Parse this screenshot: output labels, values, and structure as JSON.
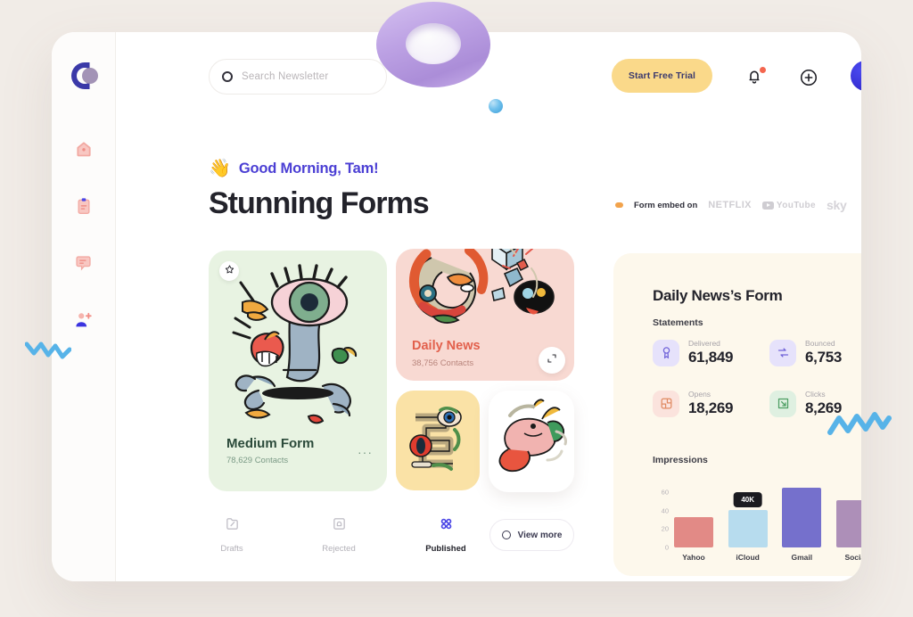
{
  "app": {
    "logo_name": "brand-logo"
  },
  "search": {
    "placeholder": "Search Newsletter",
    "value": ""
  },
  "header": {
    "cta_label": "Start Free Trial",
    "bell_icon": "notification-bell-icon",
    "plus_icon": "add-circle-icon",
    "avatar_icon": "user-avatar"
  },
  "sidebar": {
    "items": [
      {
        "name": "home",
        "icon": "home-icon",
        "active": false
      },
      {
        "name": "forms",
        "icon": "clipboard-icon",
        "active": false
      },
      {
        "name": "messages",
        "icon": "chat-bubble-icon",
        "active": false
      },
      {
        "name": "add-user",
        "icon": "add-user-icon",
        "active": true
      }
    ]
  },
  "greeting": {
    "emoji": "👋",
    "text": "Good Morning, Tam!"
  },
  "page_title": "Stunning Forms",
  "embed": {
    "label": "Form embed on",
    "brands": [
      "NETFLIX",
      "YouTube",
      "sky"
    ]
  },
  "cards": [
    {
      "id": "medium-form",
      "title": "Medium Form",
      "contacts": "78,629 Contacts",
      "pin_icon": "pin-icon",
      "more_icon": "more-options-icon",
      "bg": "#e8f3e2"
    },
    {
      "id": "daily-news",
      "title": "Daily News",
      "contacts": "38,756 Contacts",
      "expand_icon": "expand-icon",
      "bg": "#f8d9d2"
    }
  ],
  "tabs": [
    {
      "label": "Drafts",
      "icon": "drafts-icon",
      "active": false
    },
    {
      "label": "Rejected",
      "icon": "rejected-icon",
      "active": false
    },
    {
      "label": "Published",
      "icon": "grid-dots-icon",
      "active": true
    }
  ],
  "view_more": {
    "label": "View more"
  },
  "panel": {
    "title": "Daily News’s Form",
    "close_icon": "close-circle-icon",
    "statements_label": "Statements",
    "impressions_label": "Impressions",
    "stats": [
      {
        "label": "Delivered",
        "value": "61,849",
        "icon": "badge-icon",
        "icon_bg": "#e6e2fb",
        "icon_color": "#6f62d8"
      },
      {
        "label": "Bounced",
        "value": "6,753",
        "icon": "swap-icon",
        "icon_bg": "#e6e2fb",
        "icon_color": "#6f62d8"
      },
      {
        "label": "Opens",
        "value": "18,269",
        "icon": "frame-icon",
        "icon_bg": "#fbe3dd",
        "icon_color": "#e08a62"
      },
      {
        "label": "Clicks",
        "value": "8,269",
        "icon": "cursor-icon",
        "icon_bg": "#dff0e1",
        "icon_color": "#4e9e63"
      }
    ]
  },
  "chart_data": {
    "type": "bar",
    "title": "Impressions",
    "categories": [
      "Yahoo",
      "iCloud",
      "Gmail",
      "Social"
    ],
    "values": [
      33,
      41,
      65,
      52
    ],
    "colors": [
      "#e28a86",
      "#b7dcee",
      "#7570cc",
      "#ad8fb8"
    ],
    "ylim": [
      0,
      70
    ],
    "yticks": [
      0,
      20,
      40,
      60
    ],
    "ytick_labels": [
      "0",
      "20",
      "40",
      "60"
    ],
    "xlabel": "",
    "ylabel": "",
    "grid": false,
    "legend": false,
    "annotation": {
      "category": "iCloud",
      "text": "40K"
    }
  },
  "colors": {
    "accent_purple": "#4b3fd4",
    "accent_yellow": "#fad98a",
    "panel_bg": "#fdf8ec",
    "page_bg": "#f1ece7"
  }
}
